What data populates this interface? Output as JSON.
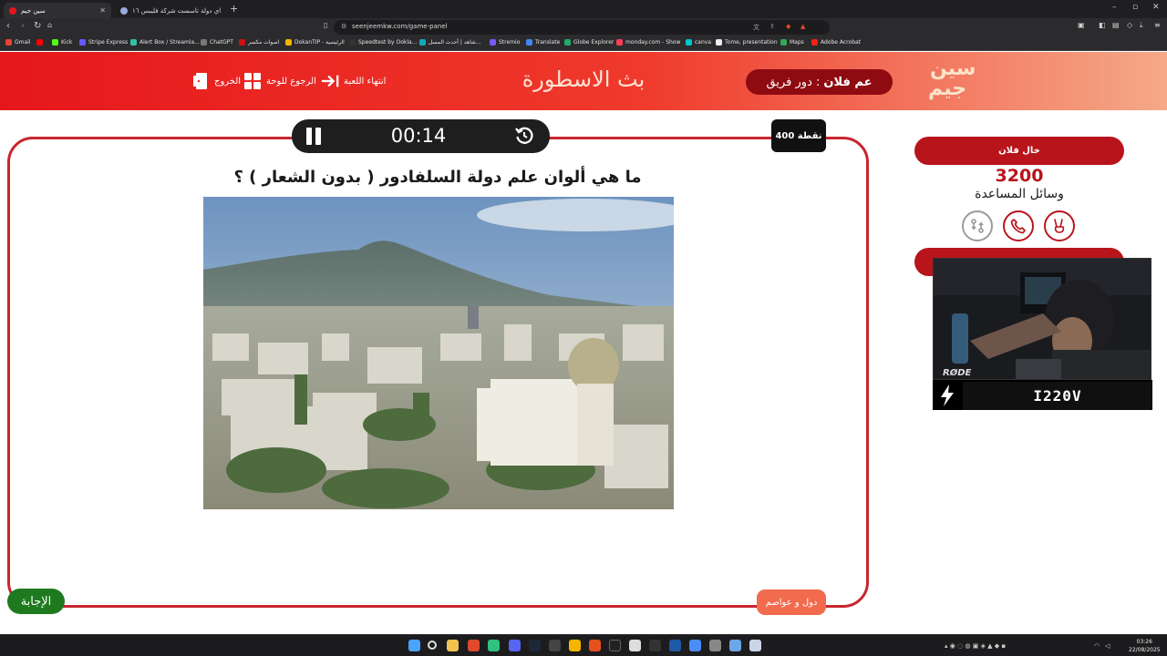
{
  "browser": {
    "tabs": [
      {
        "title": "سين جيم",
        "active": true
      },
      {
        "title": "في اي دولة تاسست شركة فليبس ١٦ ..."
      }
    ],
    "url": "seenjeemkw.com/game-panel",
    "bookmarks": [
      "Gmail",
      "Kick",
      "Stripe Express",
      "Alert Box / Streamla...",
      "ChatGPT",
      "اصوات مكسر",
      "DokanTIP - الرئيسية",
      "Speedtest by Ookla...",
      "شاهد | أحدث المسل...",
      "Stremio",
      "Translate",
      "Globe Explorer",
      "monday.com - Show",
      "canva",
      "Tome, presentation",
      "Maps",
      "Adobe Acrobat"
    ]
  },
  "header": {
    "logo_line1": "سين",
    "logo_line2": "جيم",
    "turn_label": "دور فريق :",
    "turn_team": "عم فلان",
    "game_title": "بث الاسطورة",
    "end_game": "انتهاء اللعبة",
    "back_to_board": "الرجوع للوحة",
    "exit": "الخروج"
  },
  "timer": {
    "time": "00:14"
  },
  "question": {
    "points": "400 نقطة",
    "text": "ما هي ألوان علم دولة السلفادور ( بدون الشعار ) ؟",
    "category": "دول و عواصم",
    "answer_button": "الإجابة"
  },
  "team": {
    "name": "خال فلان",
    "score": "3200",
    "helpers_label": "وسائل المساعدة"
  },
  "stream": {
    "mic_brand": "RØDE",
    "streamer_name": "I220V"
  },
  "taskbar": {
    "time": "03:26",
    "date": "22/08/2025"
  },
  "colors": {
    "brand_red": "#e6171b",
    "dark_red": "#8e0b12",
    "answer_green": "#1f7a1f",
    "category_orange": "#f26b4f"
  }
}
